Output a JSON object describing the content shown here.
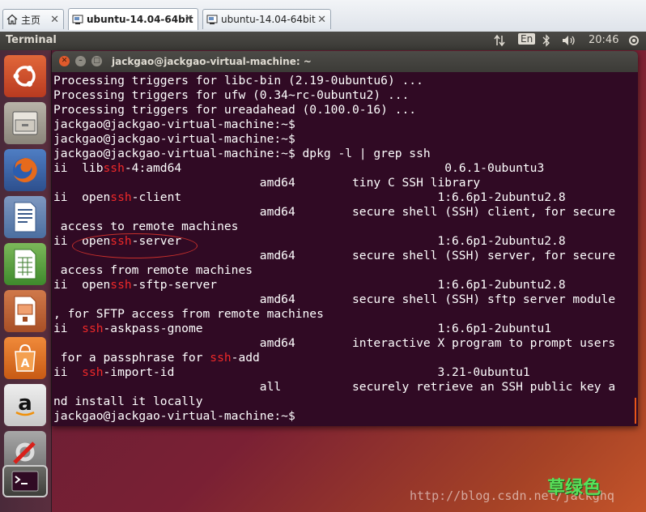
{
  "tabs": [
    {
      "label": "主页",
      "icon": "home-icon"
    },
    {
      "label": "ubuntu-14.04-64bit",
      "icon": "vm-icon"
    },
    {
      "label": "ubuntu-14.04-64bit",
      "icon": "vm-icon"
    }
  ],
  "topbar": {
    "app_title": "Terminal",
    "keyboard_layout": "En",
    "clock": "20:46"
  },
  "launcher": [
    {
      "name": "ubuntu-dash"
    },
    {
      "name": "files"
    },
    {
      "name": "firefox"
    },
    {
      "name": "libreoffice-writer"
    },
    {
      "name": "libreoffice-calc"
    },
    {
      "name": "libreoffice-impress"
    },
    {
      "name": "ubuntu-software-center"
    },
    {
      "name": "amazon"
    },
    {
      "name": "system-settings"
    },
    {
      "name": "terminal"
    }
  ],
  "window": {
    "title": "jackgao@jackgao-virtual-machine: ~"
  },
  "terminal_lines": [
    [
      {
        "t": "Processing triggers for libc-bin (2.19-0ubuntu6) ..."
      }
    ],
    [
      {
        "t": "Processing triggers for ufw (0.34~rc-0ubuntu2) ..."
      }
    ],
    [
      {
        "t": "Processing triggers for ureadahead (0.100.0-16) ..."
      }
    ],
    [
      {
        "t": "jackgao@jackgao-virtual-machine:~$"
      }
    ],
    [
      {
        "t": "jackgao@jackgao-virtual-machine:~$"
      }
    ],
    [
      {
        "t": "jackgao@jackgao-virtual-machine:~$ dpkg -l | grep ssh"
      }
    ],
    [
      {
        "t": "ii  lib"
      },
      {
        "t": "ssh",
        "hl": true
      },
      {
        "t": "-4:amd64                                     0.6.1-0ubuntu3"
      }
    ],
    [
      {
        "t": "                             amd64        tiny C SSH library"
      }
    ],
    [
      {
        "t": "ii  open"
      },
      {
        "t": "ssh",
        "hl": true
      },
      {
        "t": "-client                                    1:6.6p1-2ubuntu2.8"
      }
    ],
    [
      {
        "t": "                             amd64        secure shell (SSH) client, for secure"
      }
    ],
    [
      {
        "t": " access to remote machines"
      }
    ],
    [
      {
        "t": "ii  open"
      },
      {
        "t": "ssh",
        "hl": true
      },
      {
        "t": "-server                                    1:6.6p1-2ubuntu2.8"
      }
    ],
    [
      {
        "t": "                             amd64        secure shell (SSH) server, for secure"
      }
    ],
    [
      {
        "t": " access from remote machines"
      }
    ],
    [
      {
        "t": "ii  open"
      },
      {
        "t": "ssh",
        "hl": true
      },
      {
        "t": "-sftp-server                               1:6.6p1-2ubuntu2.8"
      }
    ],
    [
      {
        "t": "                             amd64        secure shell (SSH) sftp server module"
      }
    ],
    [
      {
        "t": ", for SFTP access from remote machines"
      }
    ],
    [
      {
        "t": "ii  "
      },
      {
        "t": "ssh",
        "hl": true
      },
      {
        "t": "-askpass-gnome                                 1:6.6p1-2ubuntu1"
      }
    ],
    [
      {
        "t": "                             amd64        interactive X program to prompt users"
      }
    ],
    [
      {
        "t": " for a passphrase for "
      },
      {
        "t": "ssh",
        "hl": true
      },
      {
        "t": "-add"
      }
    ],
    [
      {
        "t": "ii  "
      },
      {
        "t": "ssh",
        "hl": true
      },
      {
        "t": "-import-id                                     3.21-0ubuntu1"
      }
    ],
    [
      {
        "t": "                             all          securely retrieve an SSH public key a"
      }
    ],
    [
      {
        "t": "nd install it locally"
      }
    ],
    [
      {
        "t": "jackgao@jackgao-virtual-machine:~$"
      }
    ]
  ],
  "watermark": {
    "text_cn": "草绿色",
    "url": "http://blog.csdn.net/jackghq"
  },
  "colors": {
    "terminal_bg": "#300a24",
    "terminal_fg": "#ffffff",
    "grep_highlight": "#ef2929",
    "annotation_ellipse": "#c9302c"
  }
}
